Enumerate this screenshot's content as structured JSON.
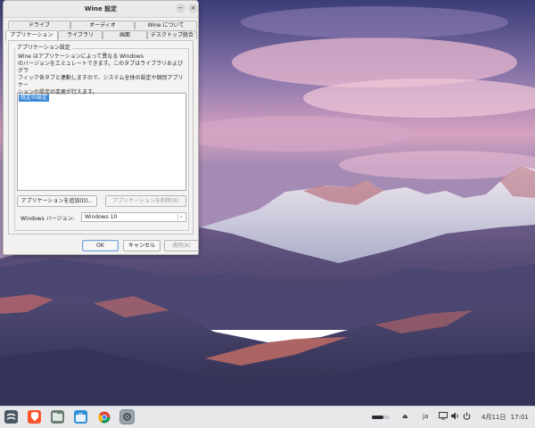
{
  "window": {
    "title": "Wine 設定",
    "minimize_glyph": "−",
    "close_glyph": "×",
    "tabs_row1": [
      "ドライブ",
      "オーディオ",
      "Wine について"
    ],
    "tabs_row2": [
      "アプリケーション",
      "ライブラリ",
      "画面",
      "デスクトップ統合"
    ],
    "active_tab": "アプリケーション",
    "group_label": "アプリケーション設定",
    "description": [
      "Wine はアプリケーションによって異なる Windows",
      "のバージョンをエミュレートできます。このタブはライブラリおよびグラ",
      "フィック各タブと連動しますので、システム全体の設定や個別アプリケー",
      "ションの設定の変更が行えます。"
    ],
    "list_items": [
      "既定の設定"
    ],
    "add_app_button": "アプリケーションを追加(D)...",
    "remove_app_button": "アプリケーションを削除(R)",
    "windows_version_label": "Windows バージョン:",
    "windows_version_value": "Windows 10",
    "ok_button": "OK",
    "cancel_button": "キャンセル",
    "apply_button": "適用(A)"
  },
  "taskbar": {
    "apps": [
      "system-menu-icon",
      "brave-browser-icon",
      "file-manager-icon",
      "store-icon",
      "chrome-icon",
      "wine-settings-icon"
    ],
    "language": "ja",
    "date": "4月11日",
    "time": "17:01"
  },
  "colors": {
    "selection": "#3a87d6",
    "taskbar": "#e8e8ea"
  }
}
